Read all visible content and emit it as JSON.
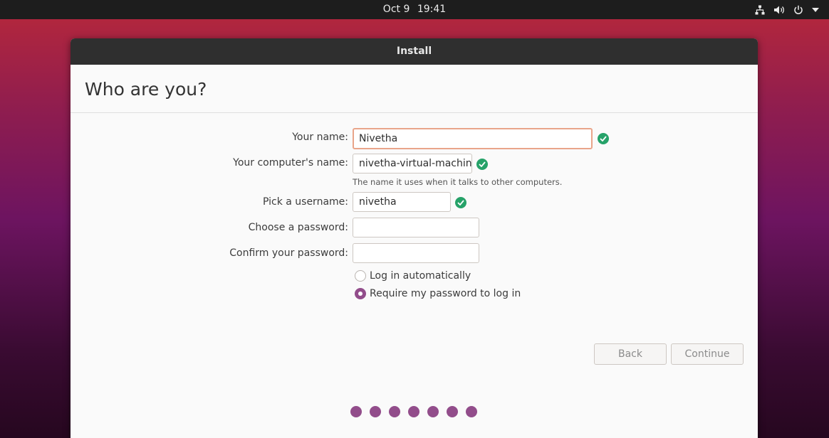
{
  "topbar": {
    "date": "Oct 9",
    "time": "19:41"
  },
  "window": {
    "title": "Install",
    "heading": "Who are you?"
  },
  "form": {
    "name_label": "Your name:",
    "name_value": "Nivetha",
    "computer_label": "Your computer's name:",
    "computer_value": "nivetha-virtual-machine",
    "computer_hint": "The name it uses when it talks to other computers.",
    "username_label": "Pick a username:",
    "username_value": "nivetha",
    "password_label": "Choose a password:",
    "password_value": "",
    "confirm_label": "Confirm your password:",
    "confirm_value": "",
    "login_auto_label": "Log in automatically",
    "login_password_label": "Require my password to log in",
    "selected_login_option": "Require my password to log in"
  },
  "buttons": {
    "back": "Back",
    "continue": "Continue"
  },
  "progress": {
    "step_count": 7
  },
  "colors": {
    "accent": "#924d8b",
    "valid": "#26a269",
    "focus_border": "#e9a58a"
  }
}
